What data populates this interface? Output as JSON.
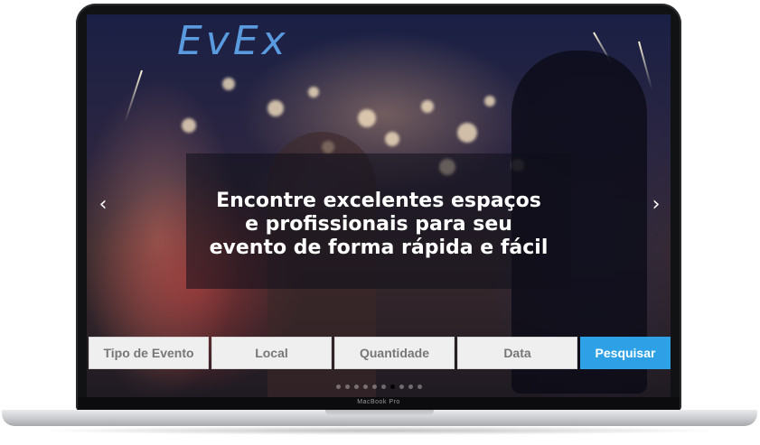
{
  "brand": {
    "logo_text": "EvEx",
    "logo_color": "#5a9be0"
  },
  "hero": {
    "headline_lines": [
      "Encontre excelentes espaços",
      "e profissionais para seu",
      "evento de forma rápida e fácil"
    ]
  },
  "carousel": {
    "prev_icon": "chevron-left-icon",
    "next_icon": "chevron-right-icon",
    "prev_glyph": "‹",
    "next_glyph": "›",
    "slide_count": 10,
    "active_slide": 6
  },
  "search": {
    "fields": [
      {
        "name": "event-type-field",
        "label": "Tipo de Evento"
      },
      {
        "name": "location-field",
        "label": "Local"
      },
      {
        "name": "quantity-field",
        "label": "Quantidade"
      },
      {
        "name": "date-field",
        "label": "Data"
      }
    ],
    "submit_label": "Pesquisar",
    "accent_color": "#2ea0e6"
  },
  "device": {
    "model_label": "MacBook Pro"
  }
}
